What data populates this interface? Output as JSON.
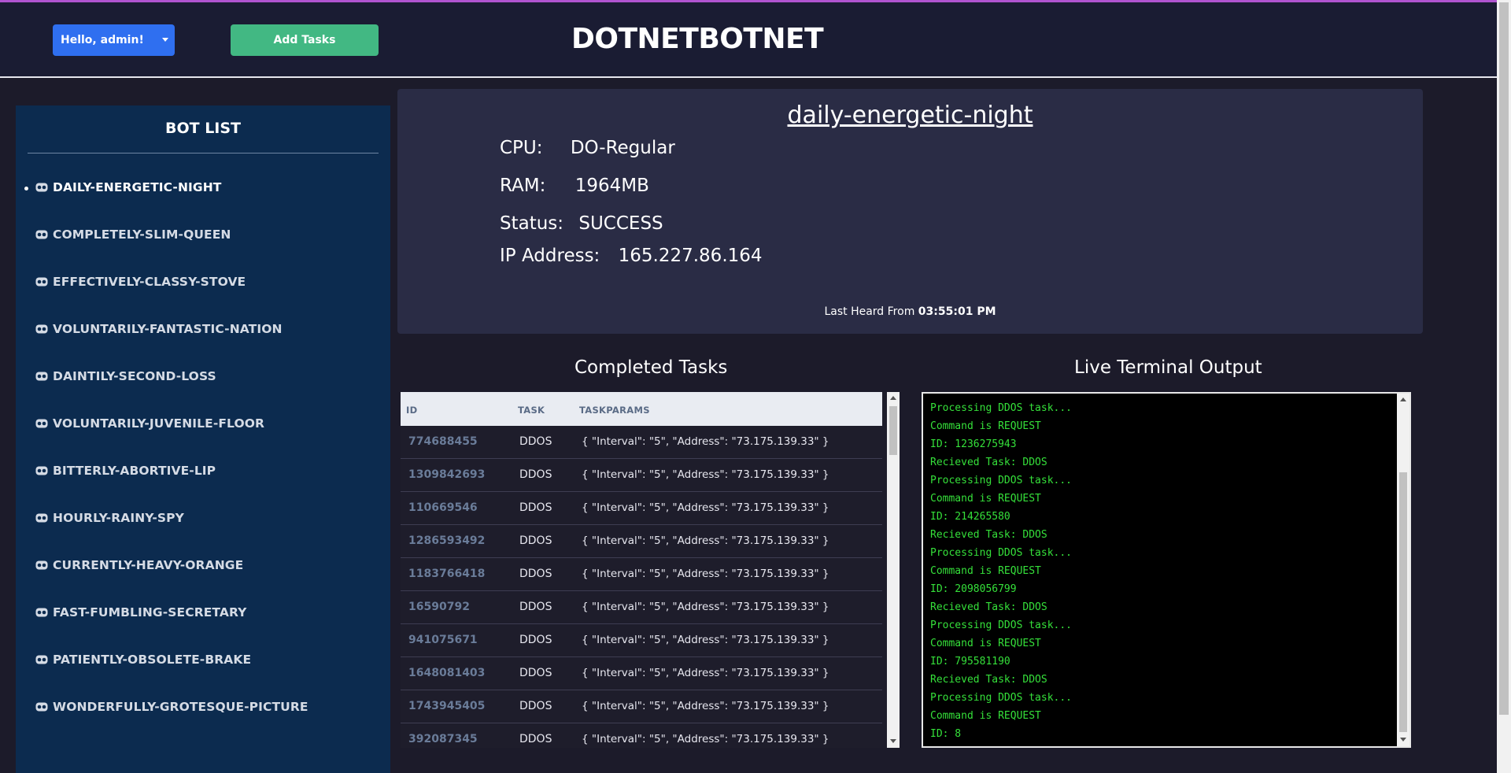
{
  "header": {
    "user_menu_label": "Hello, admin!",
    "add_tasks_label": "Add Tasks",
    "brand": "DOTNETBOTNET"
  },
  "sidebar": {
    "title": "BOT LIST",
    "items": [
      {
        "label": "DAILY-ENERGETIC-NIGHT",
        "active": true
      },
      {
        "label": "COMPLETELY-SLIM-QUEEN"
      },
      {
        "label": "EFFECTIVELY-CLASSY-STOVE"
      },
      {
        "label": "VOLUNTARILY-FANTASTIC-NATION"
      },
      {
        "label": "DAINTILY-SECOND-LOSS"
      },
      {
        "label": "VOLUNTARILY-JUVENILE-FLOOR"
      },
      {
        "label": "BITTERLY-ABORTIVE-LIP"
      },
      {
        "label": "HOURLY-RAINY-SPY"
      },
      {
        "label": "CURRENTLY-HEAVY-ORANGE"
      },
      {
        "label": "FAST-FUMBLING-SECRETARY"
      },
      {
        "label": "PATIENTLY-OBSOLETE-BRAKE"
      },
      {
        "label": "WONDERFULLY-GROTESQUE-PICTURE"
      }
    ]
  },
  "bot": {
    "name": "daily-energetic-night",
    "cpu_label": "CPU:",
    "cpu": "DO-Regular",
    "ram_label": "RAM:",
    "ram": "1964MB",
    "status_label": "Status:",
    "status": "SUCCESS",
    "ip_label": "IP Address:",
    "ip": "165.227.86.164",
    "last_heard_label": "Last Heard From",
    "last_heard": "03:55:01 PM"
  },
  "tasks": {
    "title": "Completed Tasks",
    "columns": [
      "ID",
      "TASK",
      "TASKPARAMS"
    ],
    "rows": [
      [
        "774688455",
        "DDOS",
        "{ \"Interval\": \"5\", \"Address\": \"73.175.139.33\" }"
      ],
      [
        "1309842693",
        "DDOS",
        "{ \"Interval\": \"5\", \"Address\": \"73.175.139.33\" }"
      ],
      [
        "110669546",
        "DDOS",
        "{ \"Interval\": \"5\", \"Address\": \"73.175.139.33\" }"
      ],
      [
        "1286593492",
        "DDOS",
        "{ \"Interval\": \"5\", \"Address\": \"73.175.139.33\" }"
      ],
      [
        "1183766418",
        "DDOS",
        "{ \"Interval\": \"5\", \"Address\": \"73.175.139.33\" }"
      ],
      [
        "16590792",
        "DDOS",
        "{ \"Interval\": \"5\", \"Address\": \"73.175.139.33\" }"
      ],
      [
        "941075671",
        "DDOS",
        "{ \"Interval\": \"5\", \"Address\": \"73.175.139.33\" }"
      ],
      [
        "1648081403",
        "DDOS",
        "{ \"Interval\": \"5\", \"Address\": \"73.175.139.33\" }"
      ],
      [
        "1743945405",
        "DDOS",
        "{ \"Interval\": \"5\", \"Address\": \"73.175.139.33\" }"
      ],
      [
        "392087345",
        "DDOS",
        "{ \"Interval\": \"5\", \"Address\": \"73.175.139.33\" }"
      ]
    ]
  },
  "terminal": {
    "title": "Live Terminal Output",
    "lines": [
      "Processing DDOS task...",
      "Command is REQUEST",
      "ID: 1236275943",
      "Recieved Task: DDOS",
      "Processing DDOS task...",
      "Command is REQUEST",
      "ID: 214265580",
      "Recieved Task: DDOS",
      "Processing DDOS task...",
      "Command is REQUEST",
      "ID: 2098056799",
      "Recieved Task: DDOS",
      "Processing DDOS task...",
      "Command is REQUEST",
      "ID: 795581190",
      "Recieved Task: DDOS",
      "Processing DDOS task...",
      "Command is REQUEST",
      "ID: 8"
    ]
  },
  "colors": {
    "header_bg": "#1a1c33",
    "sidebar_bg": "#0c2b4f",
    "card_bg": "#2a2c45",
    "user_button": "#2f6ff0",
    "add_button": "#42b883",
    "terminal_text": "#35e03a",
    "accent_line": "#b054d0"
  },
  "icons": {
    "bot_item": "bot-face-icon",
    "user_menu": "caret-down-icon"
  }
}
